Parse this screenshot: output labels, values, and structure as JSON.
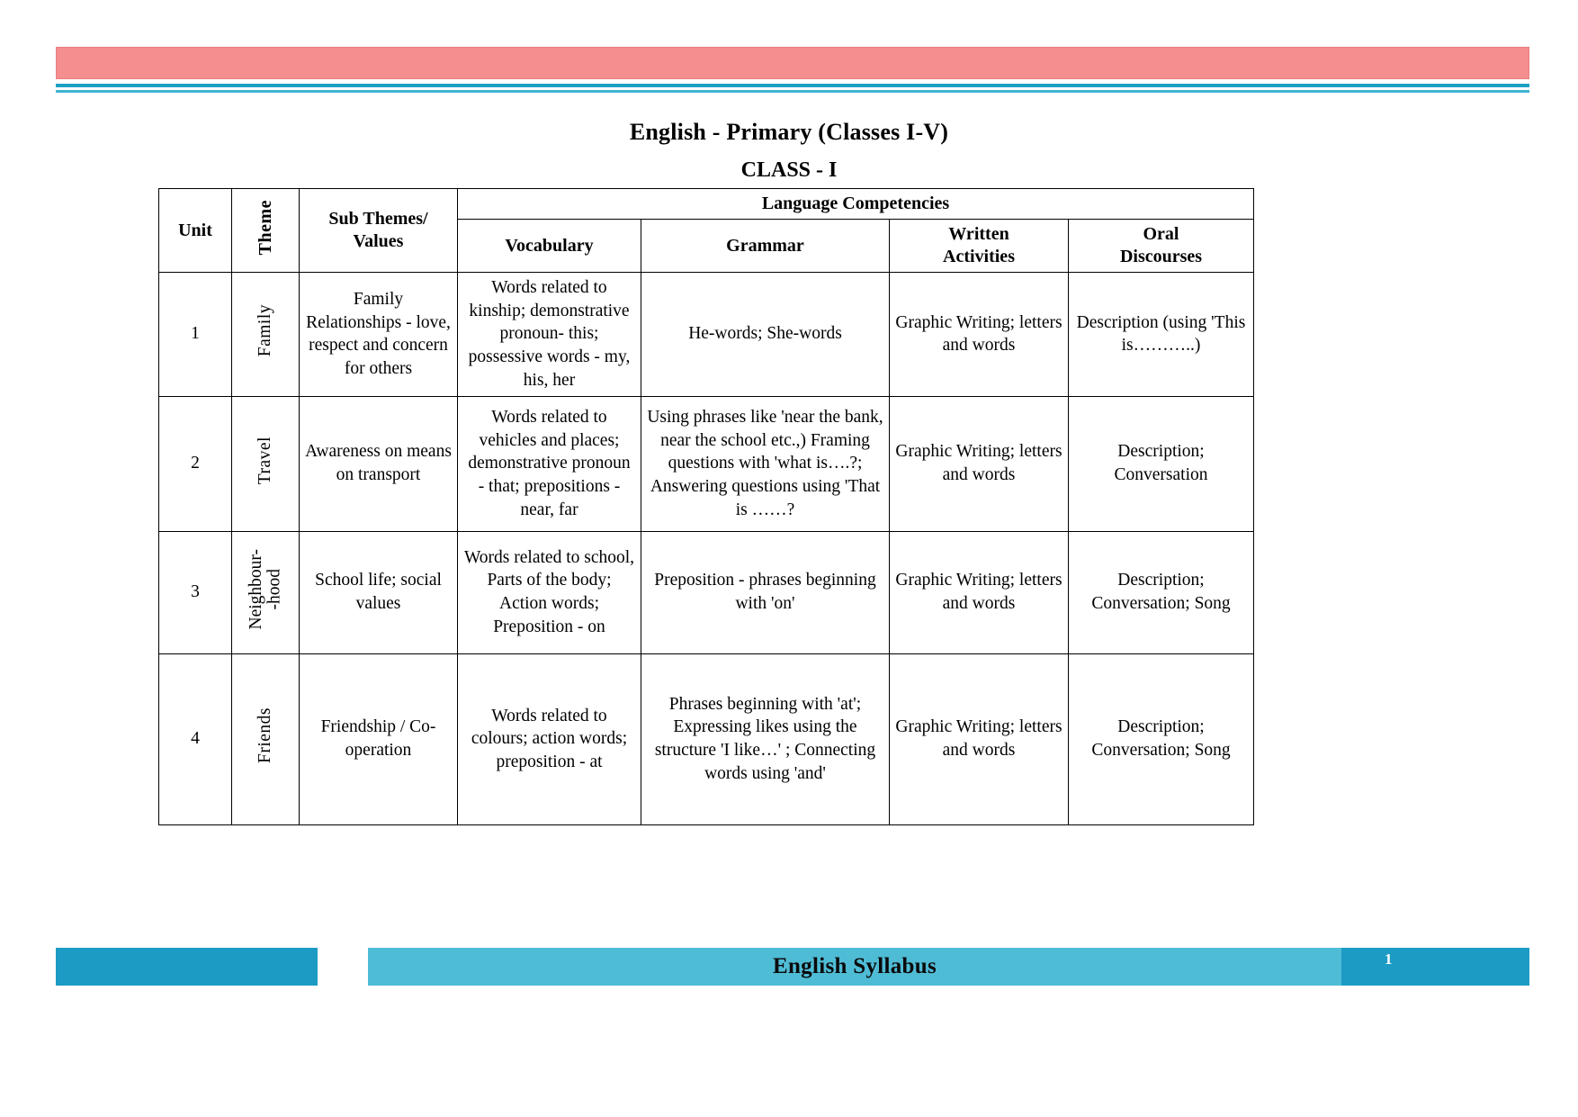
{
  "document": {
    "title": "English - Primary (Classes I-V)",
    "subtitle": "CLASS - I"
  },
  "table": {
    "headers": {
      "unit": "Unit",
      "theme": "Theme",
      "sub_themes_line1": "Sub Themes/",
      "sub_themes_line2": "Values",
      "language_competencies": "Language Competencies",
      "vocabulary": "Vocabulary",
      "grammar": "Grammar",
      "written_line1": "Written",
      "written_line2": "Activities",
      "oral_line1": "Oral",
      "oral_line2": "Discourses"
    },
    "rows": [
      {
        "unit": "1",
        "theme": "Family",
        "theme_line2": "",
        "sub_themes": "Family Relationships - love, respect  and concern for others",
        "vocabulary": "Words related to kinship; demonstrative pronoun- this; possessive words - my, his, her",
        "grammar": "He-words; She-words",
        "written": "Graphic Writing; letters and words",
        "oral": "Description (using 'This is………..)"
      },
      {
        "unit": "2",
        "theme": "Travel",
        "theme_line2": "",
        "sub_themes": "Awareness on means on transport",
        "vocabulary": "Words related to vehicles and places; demonstrative pronoun - that; prepositions - near, far",
        "grammar": "Using  phrases like 'near the bank, near the school etc.,) Framing questions  with 'what is….?; Answering questions using 'That is ……?",
        "written": "Graphic Writing; letters and words",
        "oral": "Description; Conversation"
      },
      {
        "unit": "3",
        "theme": "Neighbour-",
        "theme_line2": "-hood",
        "sub_themes": "School life; social values",
        "vocabulary": "Words related to school, Parts of the body; Action words; Preposition - on",
        "grammar": "Preposition - phrases beginning with 'on'",
        "written": "Graphic Writing; letters and words",
        "oral": "Description; Conversation; Song"
      },
      {
        "unit": "4",
        "theme": "Friends",
        "theme_line2": "",
        "sub_themes": "Friendship / Co-operation",
        "vocabulary": "Words related to colours; action words; preposition - at",
        "grammar": "Phrases beginning with 'at'; Expressing likes using the structure 'I like…' ; Connecting words using 'and'",
        "written": "Graphic Writing; letters and words",
        "oral": "Description; Conversation; Song"
      }
    ]
  },
  "footer": {
    "label": "English Syllabus",
    "page_number": "1"
  },
  "colors": {
    "header_pink": "#F58E8E",
    "header_teal": "#1FA0C4",
    "footer_dark_teal": "#1C9CC4",
    "footer_light_teal": "#4FBCD6"
  }
}
